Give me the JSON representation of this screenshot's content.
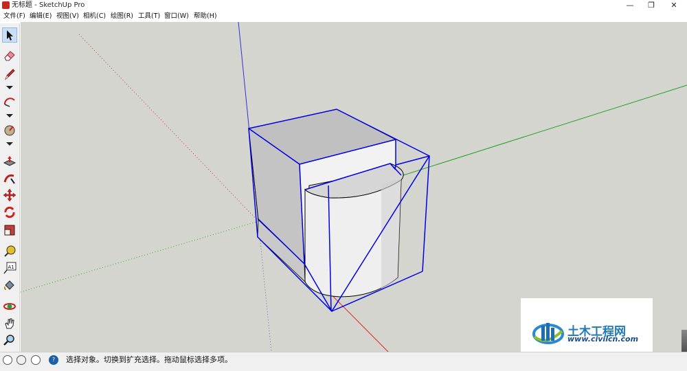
{
  "window": {
    "title": "无标题 - SketchUp Pro",
    "minimize": "—",
    "restore": "❐",
    "close": "✕"
  },
  "menu": [
    {
      "label": "文件(F)"
    },
    {
      "label": "编辑(E)"
    },
    {
      "label": "视图(V)"
    },
    {
      "label": "相机(C)"
    },
    {
      "label": "绘图(R)"
    },
    {
      "label": "工具(T)"
    },
    {
      "label": "窗口(W)"
    },
    {
      "label": "帮助(H)"
    }
  ],
  "tools": [
    "select-icon",
    "eraser-icon",
    "pencil-line-icon",
    "arc-icon",
    "shape-icon",
    "push-pull-icon",
    "follow-me-icon",
    "move-icon",
    "rotate-icon",
    "scale-icon",
    "tape-measure-icon",
    "text-icon",
    "paint-bucket-icon",
    "orbit-icon",
    "pan-icon",
    "zoom-icon"
  ],
  "text_tool_label": "A1",
  "status": {
    "message": "选择对象。切换到扩充选择。拖动鼠标选择多项。",
    "help_icon_label": "?"
  },
  "watermark": {
    "title": "土木工程网",
    "url": "www.civilcn.com"
  },
  "colors": {
    "viewport_bg": "#d5d5d0",
    "selection_blue": "#0000e6",
    "axis_red": "#e02020",
    "axis_green": "#20a020",
    "axis_blue": "#2020d0"
  }
}
